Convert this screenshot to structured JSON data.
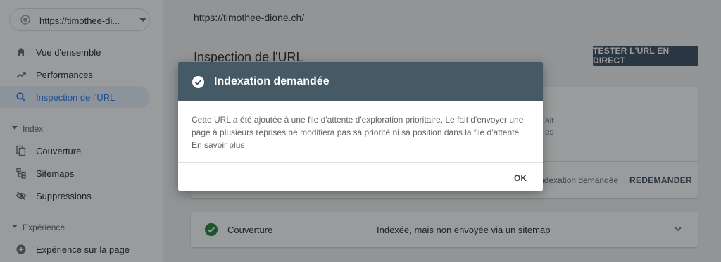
{
  "property": {
    "label": "https://timothee-di..."
  },
  "sidebar": {
    "items": [
      {
        "label": "Vue d'ensemble",
        "icon": "home-icon"
      },
      {
        "label": "Performances",
        "icon": "trending-up-icon"
      },
      {
        "label": "Inspection de l'URL",
        "icon": "search-icon",
        "active": true
      }
    ],
    "sections": [
      {
        "title": "Index",
        "items": [
          {
            "label": "Couverture",
            "icon": "file-copy-icon"
          },
          {
            "label": "Sitemaps",
            "icon": "sitemap-icon"
          },
          {
            "label": "Suppressions",
            "icon": "eye-off-icon"
          }
        ]
      },
      {
        "title": "Expérience",
        "items": [
          {
            "label": "Expérience sur la page",
            "icon": "plus-circle-icon"
          }
        ]
      }
    ]
  },
  "main": {
    "url": "https://timothee-dione.ch/",
    "title": "Inspection de l'URL",
    "live_test_button": "TESTER L'URL EN DIRECT",
    "card_partial_1": "ait",
    "card_partial_2": "es",
    "indexing_requested": "ndexation demandée",
    "request_again_button": "REDEMANDER",
    "coverage": {
      "label": "Couverture",
      "status": "Indexée, mais non envoyée via un sitemap"
    }
  },
  "dialog": {
    "title": "Indexation demandée",
    "body": "Cette URL a été ajoutée à une file d'attente d'exploration prioritaire. Le fait d'envoyer une page à plusieurs reprises ne modifiera pas sa priorité ni sa position dans la file d'attente.",
    "learn_more": "En savoir plus",
    "ok_button": "OK"
  },
  "colors": {
    "dialog_header": "#455a64",
    "live_button": "#34495e",
    "active_nav_bg": "#e8f0fe",
    "success_green": "#188038"
  }
}
